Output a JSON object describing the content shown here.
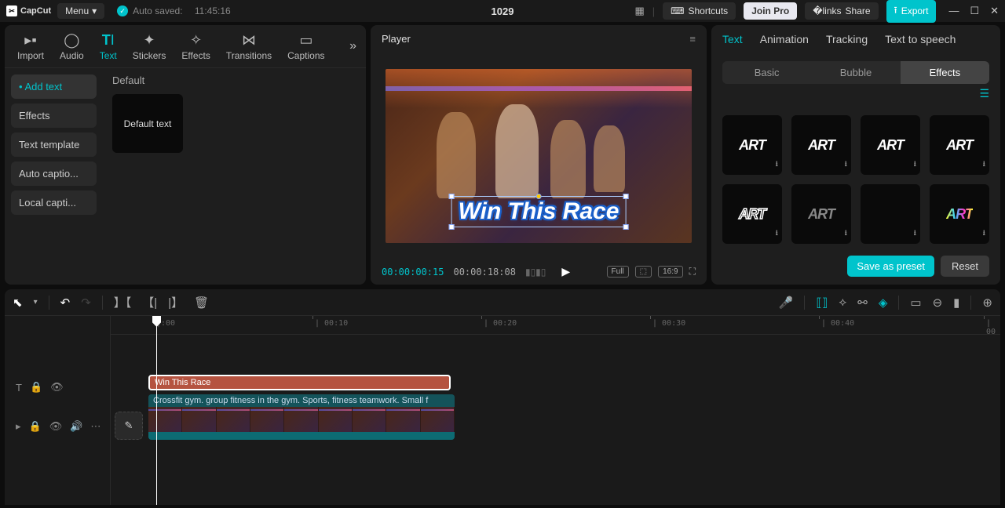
{
  "app": {
    "name": "CapCut",
    "menu": "Menu"
  },
  "autosave": {
    "label": "Auto saved:",
    "time": "11:45:16"
  },
  "project_name": "1029",
  "topbar": {
    "shortcuts": "Shortcuts",
    "join_pro": "Join Pro",
    "share": "Share",
    "export": "Export"
  },
  "media_tabs": {
    "import": "Import",
    "audio": "Audio",
    "text": "Text",
    "stickers": "Stickers",
    "effects": "Effects",
    "transitions": "Transitions",
    "captions": "Captions"
  },
  "text_sidebar": {
    "add_text": "Add text",
    "effects": "Effects",
    "text_template": "Text template",
    "auto_captions": "Auto captio...",
    "local_captions": "Local capti..."
  },
  "text_content": {
    "heading": "Default",
    "default_text": "Default text"
  },
  "player": {
    "title": "Player",
    "overlay_text": "Win This Race",
    "time_current": "00:00:00:15",
    "time_duration": "00:00:18:08",
    "badges": {
      "full": "Full",
      "ratio": "16:9"
    }
  },
  "inspector": {
    "tabs": {
      "text": "Text",
      "animation": "Animation",
      "tracking": "Tracking",
      "tts": "Text to speech"
    },
    "subtabs": {
      "basic": "Basic",
      "bubble": "Bubble",
      "effects": "Effects"
    },
    "effect_label": "ART",
    "save_preset": "Save as preset",
    "reset": "Reset"
  },
  "timeline": {
    "marks": [
      "|:00",
      "| 00:10",
      "| 00:20",
      "| 00:30",
      "| 00:40",
      "| 00"
    ],
    "text_clip": "Win This Race",
    "video_clip": "Crossfit gym. group fitness in the gym. Sports, fitness teamwork. Small f"
  }
}
